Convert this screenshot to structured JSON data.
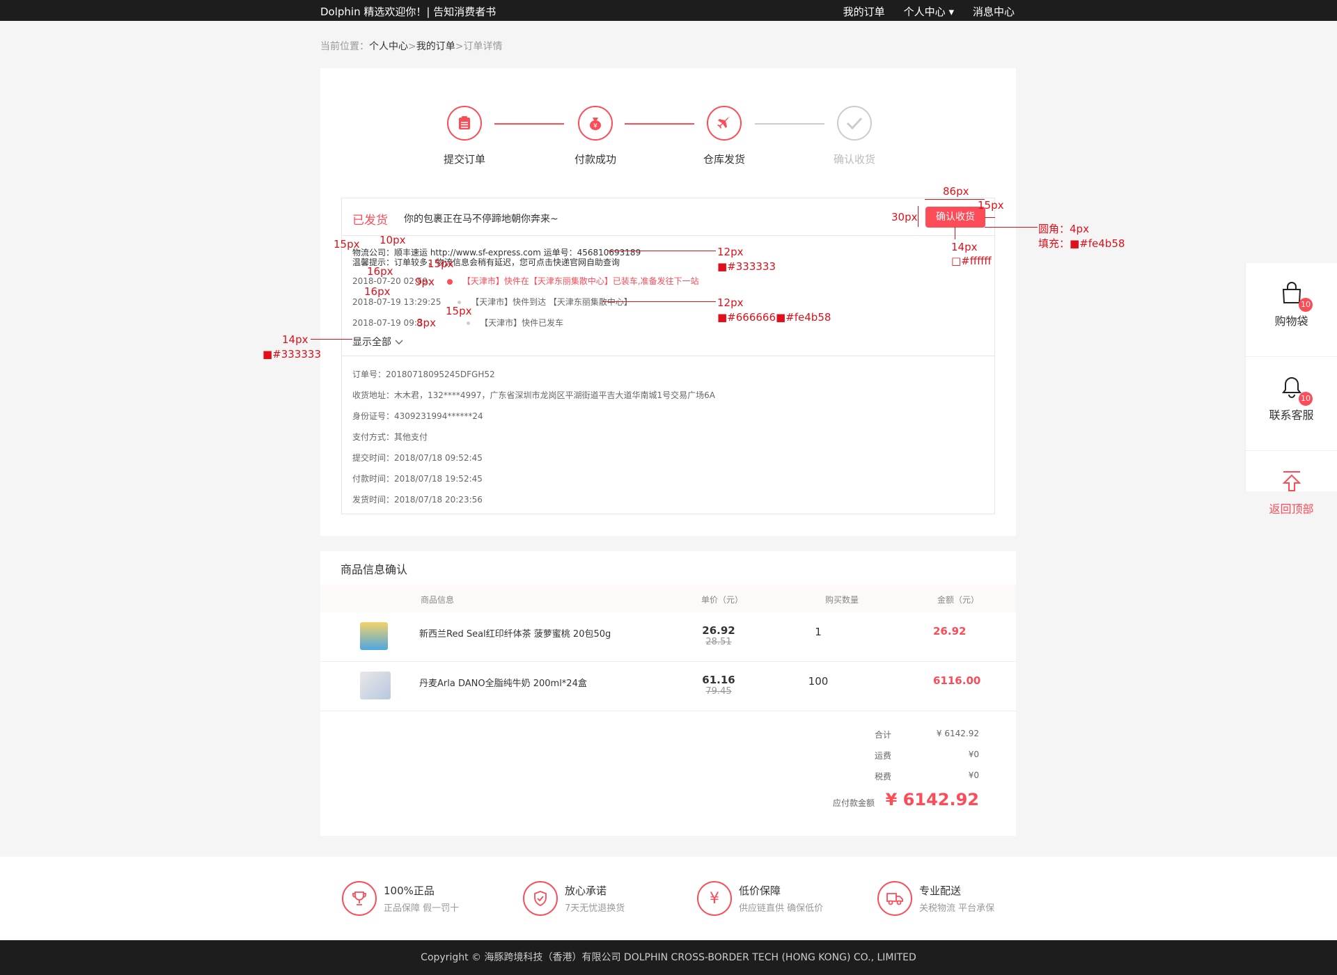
{
  "topbar": {
    "welcome": "Dolphin 精选欢迎你！| 告知消费者书",
    "my_orders": "我的订单",
    "personal_center": "个人中心 ▾",
    "messages": "消息中心"
  },
  "breadcrumb": {
    "label": "当前位置：",
    "crumb1": "个人中心",
    "sep1": ">",
    "crumb2": "我的订单",
    "sep2": ">",
    "crumb3": "订单详情"
  },
  "steps": [
    {
      "label": "提交订单"
    },
    {
      "label": "付款成功"
    },
    {
      "label": "仓库发货"
    },
    {
      "label": "确认收货"
    }
  ],
  "order_status": {
    "status": "已发货",
    "message": "你的包裹正在马不停蹄地朝你奔来~",
    "confirm_button": "确认收货"
  },
  "logistics": {
    "company_line": "物流公司：顺丰速运 http://www.sf-express.com      运单号：456810693189",
    "tip": "温馨提示：订单较多，物流信息会稍有延迟，您可点击快递官网自助查询",
    "show_all": "显示全部",
    "timeline": [
      {
        "time": "2018-07-20 02:59:",
        "text": "【天津市】快件在【天津东丽集散中心】已装车,准备发往下一站"
      },
      {
        "time": "2018-07-19 13:29:25",
        "text": "【天津市】快件到达 【天津东丽集散中心】"
      },
      {
        "time": "2018-07-19 09:3",
        "text": "【天津市】快件已发车"
      }
    ]
  },
  "order_info": [
    {
      "label": "订单号：",
      "value": "20180718095245DFGH52"
    },
    {
      "label": "收货地址：",
      "value": "木木君，132****4997，广东省深圳市龙岗区平湖街道平吉大道华南城1号交易广场6A"
    },
    {
      "label": "身份证号：",
      "value": "4309231994******24"
    },
    {
      "label": "支付方式：",
      "value": "其他支付"
    },
    {
      "label": "提交时间：",
      "value": "2018/07/18 09:52:45"
    },
    {
      "label": "付款时间：",
      "value": "2018/07/18 19:52:45"
    },
    {
      "label": "发货时间：",
      "value": "2018/07/18 20:23:56"
    }
  ],
  "goods": {
    "title": "商品信息确认",
    "columns": {
      "info": "商品信息",
      "price": "单价（元）",
      "qty": "购买数量",
      "amount": "金额（元）"
    },
    "items": [
      {
        "name": "新西兰Red Seal红印纤体茶 菠萝蜜桃 20包50g",
        "price": "26.92",
        "orig": "28.51",
        "qty": "1",
        "amount": "26.92"
      },
      {
        "name": "丹麦Arla DANO全脂纯牛奶 200ml*24盒",
        "price": "61.16",
        "orig": "79.45",
        "qty": "100",
        "amount": "6116.00"
      }
    ],
    "totals": {
      "subtotal_label": "合计",
      "subtotal": "¥ 6142.92",
      "shipping_label": "运费",
      "shipping": "¥0",
      "tax_label": "税费",
      "tax": "¥0",
      "due_label": "应付款金额",
      "due": "¥ 6142.92"
    }
  },
  "features": [
    {
      "t1": "100%正品",
      "t2": "正品保障   假一罚十"
    },
    {
      "t1": "放心承诺",
      "t2": "7天无忧退换货"
    },
    {
      "t1": "低价保障",
      "t2": "供应链直供   确保低价"
    },
    {
      "t1": "专业配送",
      "t2": "关税物流   平台承保"
    }
  ],
  "copyright": "Copyright ©   海豚跨境科技（香港）有限公司     DOLPHIN CROSS-BORDER TECH (HONG KONG) CO., LIMITED",
  "sidebar": {
    "cart": "购物袋",
    "cart_badge": "10",
    "service": "联系客服",
    "service_badge": "10",
    "top": "返回顶部"
  },
  "annotations": {
    "w86": "86px",
    "h30": "30px",
    "r15": "15px",
    "radius": "圆角：4px",
    "fill": "填充：■#fe4b58",
    "fs14": "14px",
    "white": "□#ffffff",
    "p15a": "15px",
    "p10": "10px",
    "p15b": "15px",
    "p16a": "16px",
    "p16b": "16px",
    "p9": "9px",
    "fs12a": "12px",
    "c333a": "■#333333",
    "fs12b": "12px",
    "c666": "■#666666■#fe4b58",
    "p15c": "15px",
    "p8": "8px",
    "fs14b": "14px",
    "c333b": "■#333333"
  },
  "colors": {
    "accent": "#fe4b58",
    "text": "#333333",
    "muted": "#666666"
  }
}
